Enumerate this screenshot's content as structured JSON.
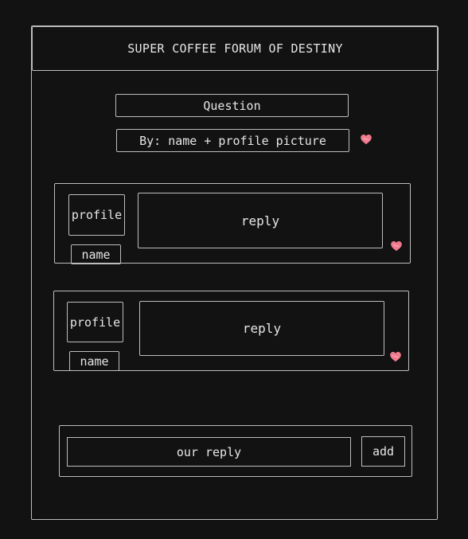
{
  "header": {
    "title": "SUPER COFFEE FORUM OF DESTINY"
  },
  "question": {
    "label": "Question",
    "byline": "By: name + profile picture"
  },
  "replies": [
    {
      "profile": "profile",
      "name": "name",
      "text": "reply"
    },
    {
      "profile": "profile",
      "name": "name",
      "text": "reply"
    }
  ],
  "compose": {
    "placeholder": "our reply",
    "add_label": "add"
  },
  "colors": {
    "background": "#121212",
    "stroke": "#bdbdbd",
    "text": "#e6e6e6",
    "heart": "#f07b8e"
  },
  "icons": {
    "like": "heart-icon"
  }
}
